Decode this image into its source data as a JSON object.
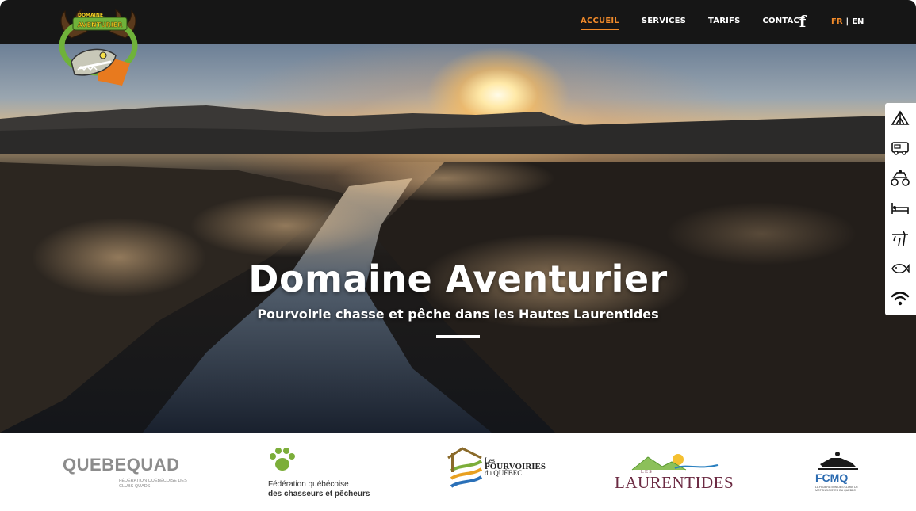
{
  "nav": {
    "items": [
      {
        "label": "ACCUEIL",
        "active": true
      },
      {
        "label": "SERVICES",
        "active": false
      },
      {
        "label": "TARIFS",
        "active": false
      },
      {
        "label": "CONTACT",
        "active": false
      }
    ],
    "facebook_icon": "facebook-icon",
    "lang": {
      "fr": "FR",
      "sep": "|",
      "en": "EN"
    }
  },
  "brand": {
    "logo_text": "DOMAINE AVENTURIER"
  },
  "hero": {
    "title": "Domaine Aventurier",
    "subtitle": "Pourvoirie chasse et pêche dans les Hautes Laurentides"
  },
  "side_tray": {
    "icons": [
      "tent-icon",
      "rv-camper-icon",
      "atv-quad-icon",
      "bed-icon",
      "hunting-icon",
      "fish-icon",
      "wifi-icon"
    ]
  },
  "partners": {
    "quebequad": {
      "name": "QUEBEQUAD",
      "subtitle": "FÉDÉRATION QUÉBÉCOISE DES CLUBS QUADS"
    },
    "fqcp": {
      "line1": "Fédération québécoise",
      "line2": "des chasseurs et pêcheurs"
    },
    "pourvoiries": {
      "line1": "Les",
      "line2": "POURVOIRIES",
      "line3": "du QUÉBEC"
    },
    "laurentides": {
      "small": "LES",
      "big": "LAURENTIDES"
    },
    "fcmq": {
      "name": "FCMQ",
      "subtitle": "LA FÉDÉRATION DES CLUBS DE MOTONEIGISTES DU QUÉBEC"
    }
  },
  "colors": {
    "accent": "#f08a2a",
    "header_bg": "#161616",
    "laurentides": "#6b2a42",
    "fcmq": "#2a6ab0"
  }
}
